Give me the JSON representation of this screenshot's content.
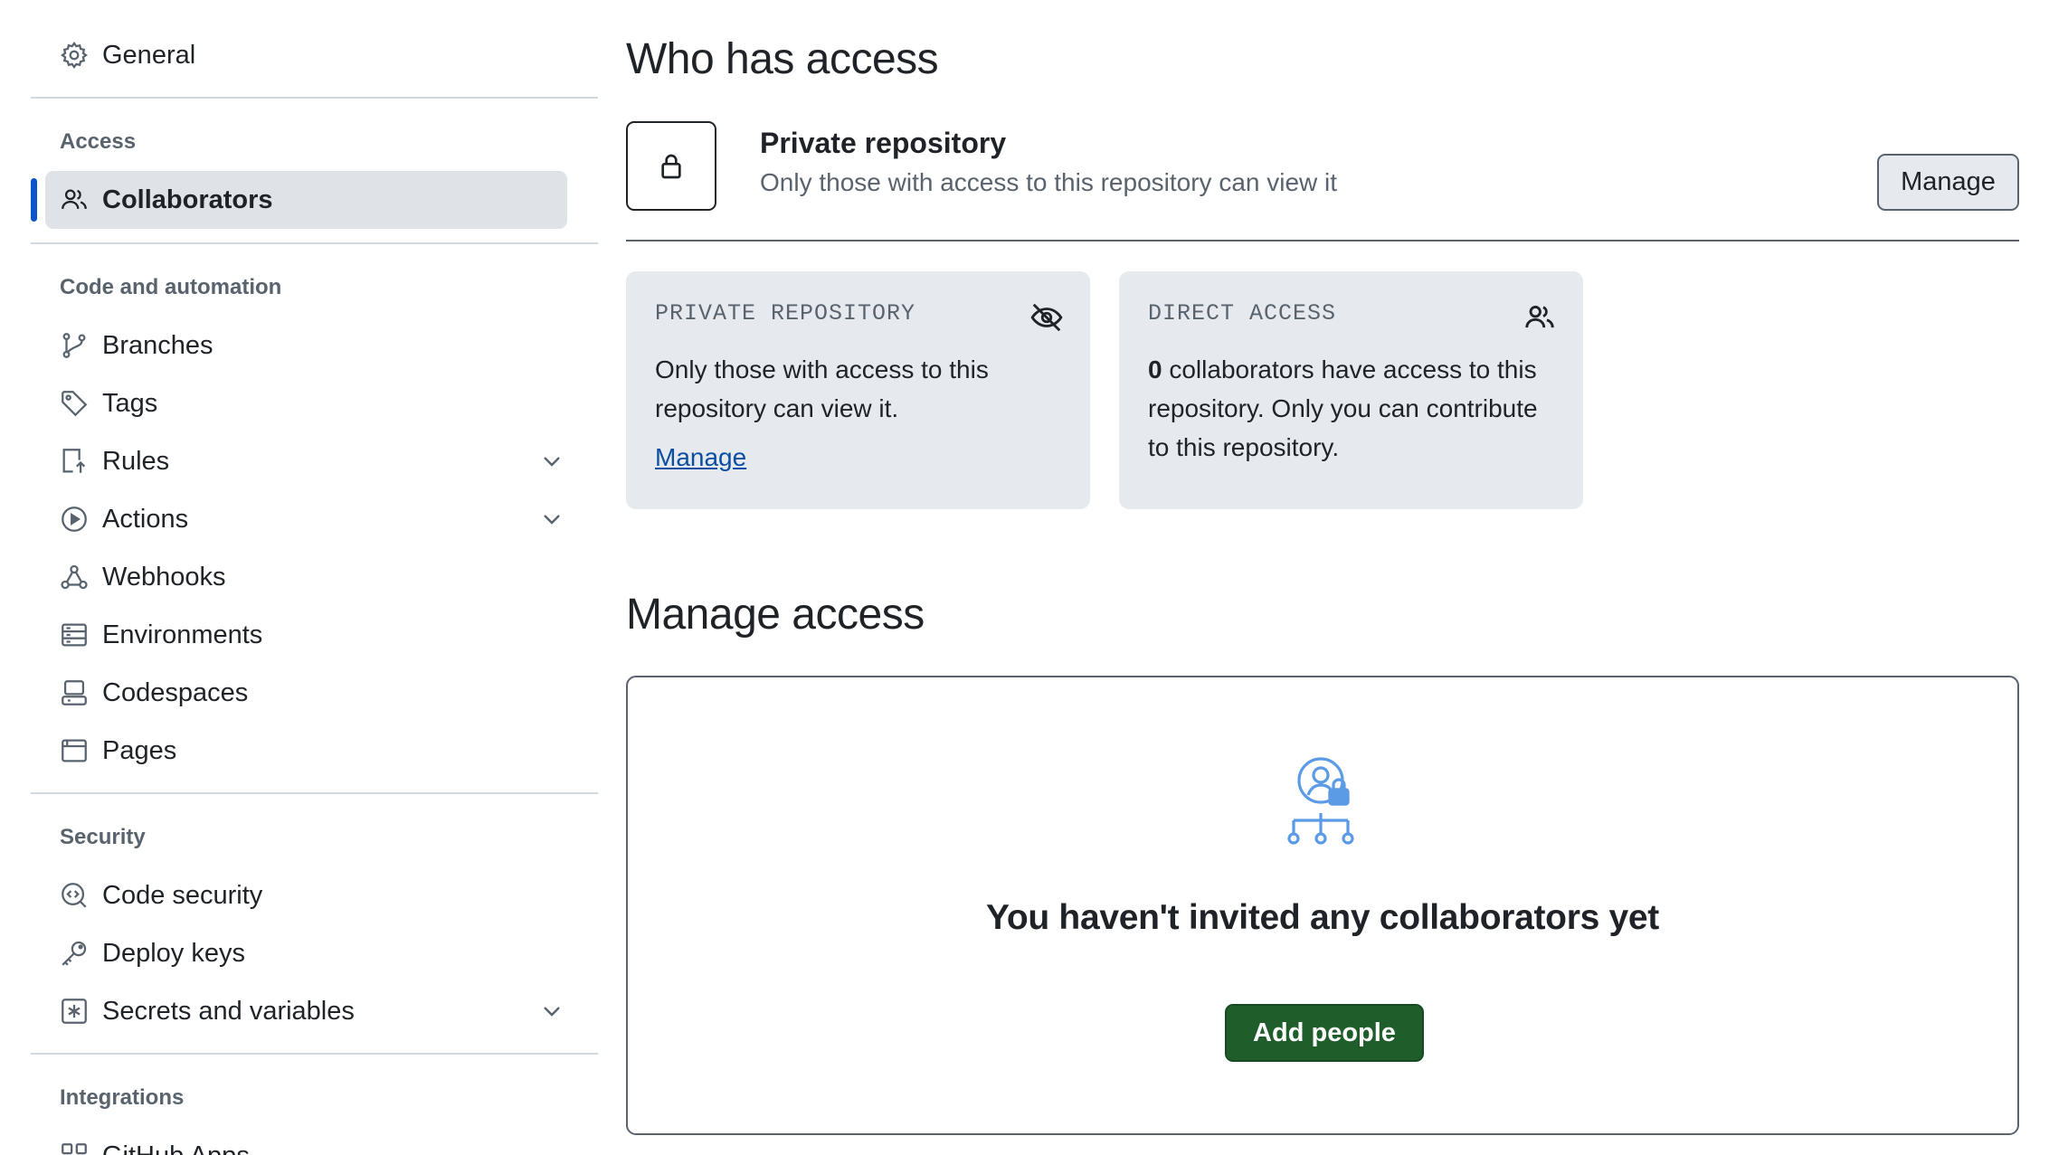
{
  "sidebar": {
    "general": "General",
    "sections": {
      "access": "Access",
      "code_automation": "Code and automation",
      "security": "Security",
      "integrations": "Integrations"
    },
    "items": {
      "collaborators": "Collaborators",
      "branches": "Branches",
      "tags": "Tags",
      "rules": "Rules",
      "actions": "Actions",
      "webhooks": "Webhooks",
      "environments": "Environments",
      "codespaces": "Codespaces",
      "pages": "Pages",
      "code_security": "Code security",
      "deploy_keys": "Deploy keys",
      "secrets": "Secrets and variables",
      "github_apps": "GitHub Apps"
    }
  },
  "main": {
    "who_title": "Who has access",
    "private_title": "Private repository",
    "private_sub": "Only those with access to this repository can view it",
    "manage_button": "Manage",
    "card_private": {
      "title": "PRIVATE REPOSITORY",
      "text": "Only those with access to this repository can view it.",
      "link": "Manage"
    },
    "card_direct": {
      "title": "DIRECT ACCESS",
      "count": "0",
      "text": " collaborators have access to this repository. Only you can contribute to this repository."
    },
    "manage_title": "Manage access",
    "empty_title": "You haven't invited any collaborators yet",
    "add_button": "Add people"
  },
  "colors": {
    "accent_blue": "#0b54c9",
    "add_button_green": "#1f5d2b",
    "link_blue": "#0b4ea2",
    "illustration_blue": "#5b9be6"
  }
}
